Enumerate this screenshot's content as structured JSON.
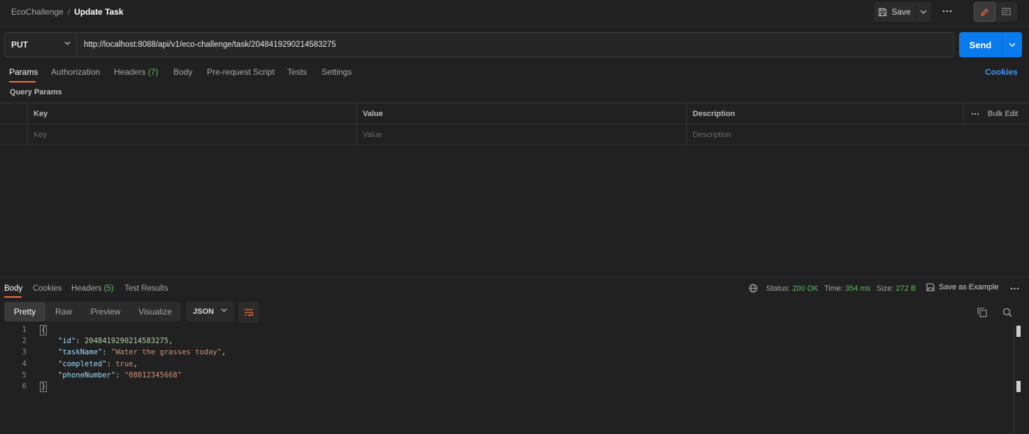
{
  "breadcrumb": {
    "parent": "EcoChallenge",
    "separator": "/",
    "current": "Update Task"
  },
  "toolbar": {
    "save_label": "Save"
  },
  "request": {
    "method": "PUT",
    "url": "http://localhost:8088/api/v1/eco-challenge/task/2048419290214583275",
    "send_label": "Send"
  },
  "request_tabs": [
    {
      "label": "Params",
      "active": true
    },
    {
      "label": "Authorization"
    },
    {
      "label": "Headers",
      "count": "(7)"
    },
    {
      "label": "Body"
    },
    {
      "label": "Pre-request Script"
    },
    {
      "label": "Tests"
    },
    {
      "label": "Settings"
    }
  ],
  "cookies_link": "Cookies",
  "query_params": {
    "title": "Query Params",
    "headers": {
      "key": "Key",
      "value": "Value",
      "description": "Description",
      "bulk_edit": "Bulk Edit"
    },
    "placeholders": {
      "key": "Key",
      "value": "Value",
      "description": "Description"
    }
  },
  "response_tabs": [
    {
      "label": "Body",
      "active": true
    },
    {
      "label": "Cookies"
    },
    {
      "label": "Headers",
      "count": "(5)"
    },
    {
      "label": "Test Results"
    }
  ],
  "response_status": {
    "status_label": "Status:",
    "status_value": "200 OK",
    "time_label": "Time:",
    "time_value": "354 ms",
    "size_label": "Size:",
    "size_value": "272 B",
    "save_example": "Save as Example"
  },
  "view_modes": [
    {
      "label": "Pretty",
      "active": true
    },
    {
      "label": "Raw"
    },
    {
      "label": "Preview"
    },
    {
      "label": "Visualize"
    }
  ],
  "format": "JSON",
  "code_lines": [
    {
      "n": "1",
      "open": "{"
    },
    {
      "n": "2",
      "key": "\"id\"",
      "sep": ": ",
      "val": "2048419290214583275",
      "type": "num",
      "tail": ","
    },
    {
      "n": "3",
      "key": "\"taskName\"",
      "sep": ": ",
      "val": "\"Water the grasses today\"",
      "type": "str",
      "tail": ","
    },
    {
      "n": "4",
      "key": "\"completed\"",
      "sep": ": ",
      "val": "true",
      "type": "bool",
      "tail": ","
    },
    {
      "n": "5",
      "key": "\"phoneNumber\"",
      "sep": ": ",
      "val": "\"08012345668\"",
      "type": "str",
      "tail": ""
    },
    {
      "n": "6",
      "close": "}"
    }
  ],
  "icons": {
    "save": "save-icon",
    "caret": "chevron-down-icon",
    "more": "more-horizontal-icon",
    "edit": "pencil-icon",
    "comment": "comment-icon",
    "globe": "globe-icon",
    "wrap": "wrap-lines-icon",
    "copy": "copy-icon",
    "search": "search-icon"
  },
  "colors": {
    "accent": "#ff6c37",
    "send": "#097bed",
    "success": "#5fb961",
    "link": "#3f95f5"
  }
}
